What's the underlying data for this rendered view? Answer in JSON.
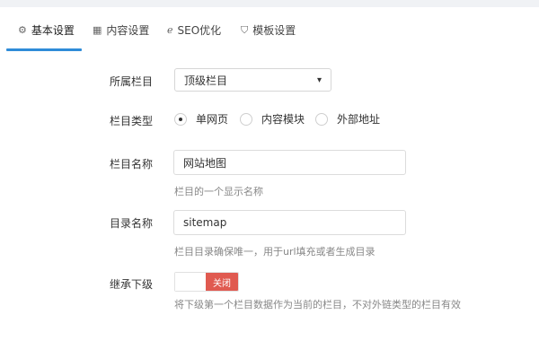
{
  "tabs": [
    {
      "icon": "gear-icon",
      "glyph": "⚙",
      "label": "基本设置"
    },
    {
      "icon": "table-icon",
      "glyph": "▦",
      "label": "内容设置"
    },
    {
      "icon": "ie-icon",
      "glyph": "ℯ",
      "label": "SEO优化"
    },
    {
      "icon": "html5-icon",
      "glyph": "⛉",
      "label": "模板设置"
    }
  ],
  "active_tab": "基本设置",
  "accent_color": "#2f8cd8",
  "form": {
    "parent": {
      "label": "所属栏目",
      "value": "顶级栏目"
    },
    "type": {
      "label": "栏目类型",
      "options": [
        "单网页",
        "内容模块",
        "外部地址"
      ],
      "selected": "单网页"
    },
    "name": {
      "label": "栏目名称",
      "value": "网站地图",
      "hint": "栏目的一个显示名称"
    },
    "dir": {
      "label": "目录名称",
      "value": "sitemap",
      "hint": "栏目目录确保唯一，用于url填充或者生成目录"
    },
    "inherit": {
      "label": "继承下级",
      "switch_text": "关闭",
      "switch_on": false,
      "hint": "将下级第一个栏目数据作为当前的栏目，不对外链类型的栏目有效"
    }
  }
}
